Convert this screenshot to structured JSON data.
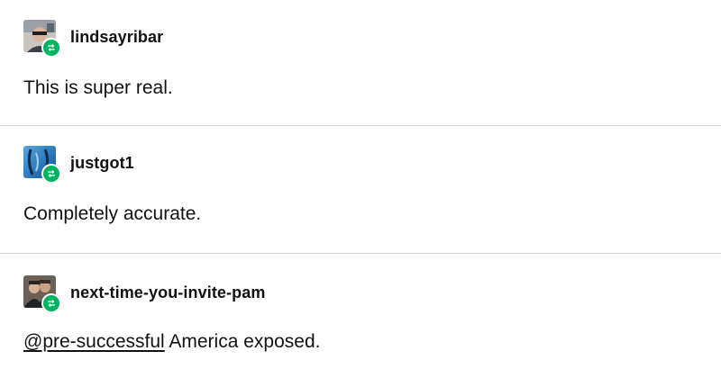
{
  "posts": [
    {
      "username": "lindsayribar",
      "avatar_icon": "user-avatar-photo",
      "badge_icon": "reblog-icon",
      "text": "This is super real."
    },
    {
      "username": "justgot1",
      "avatar_icon": "user-avatar-blue-art",
      "badge_icon": "reblog-icon",
      "text": "Completely accurate."
    },
    {
      "username": "next-time-you-invite-pam",
      "avatar_icon": "user-avatar-photo",
      "badge_icon": "reblog-icon",
      "mention": "@pre-successful",
      "text": " America exposed."
    }
  ],
  "colors": {
    "badge": "#00b35f",
    "divider": "#d8d8d8",
    "text": "#111111"
  }
}
